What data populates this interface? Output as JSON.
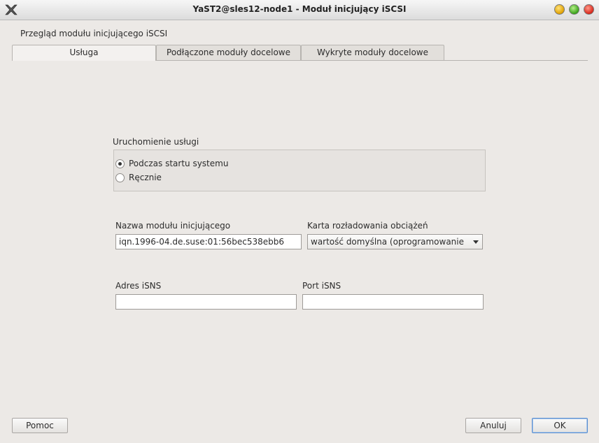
{
  "window": {
    "title": "YaST2@sles12-node1 - Moduł inicjujący iSCSI",
    "app_icon": "yast-x-icon",
    "controls": [
      "minimize-button",
      "maximize-button",
      "close-button"
    ]
  },
  "header": {
    "label": "Przegląd modułu inicjującego iSCSI"
  },
  "tabs": [
    {
      "label": "Usługa",
      "active": true
    },
    {
      "label": "Podłączone moduły docelowe",
      "active": false
    },
    {
      "label": "Wykryte moduły docelowe",
      "active": false
    }
  ],
  "service_start": {
    "label": "Uruchomienie usługi",
    "options": [
      {
        "label": "Podczas startu systemu",
        "checked": true
      },
      {
        "label": "Ręcznie",
        "checked": false
      }
    ]
  },
  "initiator": {
    "name_label": "Nazwa modułu inicjującego",
    "name_value": "iqn.1996-04.de.suse:01:56bec538ebb6",
    "offload_label": "Karta rozładowania obciążeń",
    "offload_value": "wartość domyślna (oprogramowanie"
  },
  "isns": {
    "address_label": "Adres iSNS",
    "address_value": "",
    "port_label": "Port iSNS",
    "port_value": ""
  },
  "buttons": {
    "help": "Pomoc",
    "cancel": "Anuluj",
    "ok": "OK"
  },
  "colors": {
    "background": "#ece9e6",
    "ok_border": "#5b8fd0",
    "close": "#d8261a",
    "maximize": "#3aa31a",
    "minimize": "#e0a000"
  }
}
